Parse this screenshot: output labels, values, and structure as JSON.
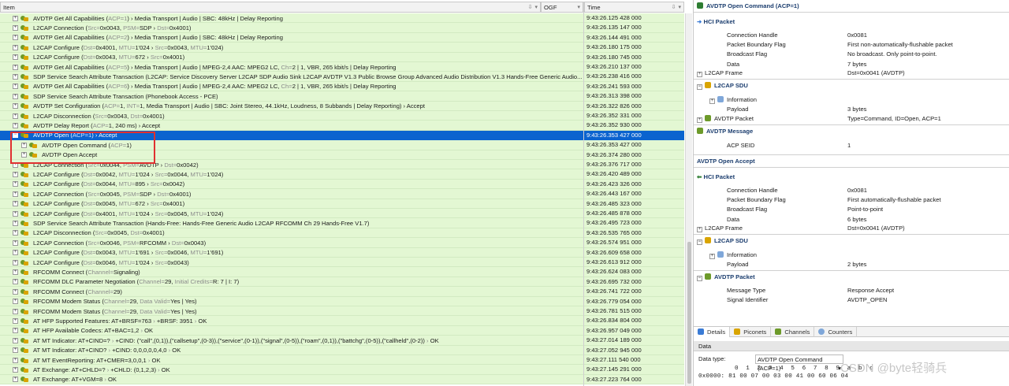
{
  "list": {
    "col_item": "Item",
    "col_ogf": "OGF",
    "col_time": "Time",
    "rows": [
      {
        "t": "+",
        "ind": 0,
        "s": [
          [
            "AVDTP Get All Capabilities (",
            0
          ],
          [
            "ACP=1",
            1
          ],
          [
            ") › Media Transport | Audio | SBC: 48kHz | Delay Reporting",
            0
          ]
        ],
        "time": "9:43:26.125 428 000"
      },
      {
        "t": "+",
        "ind": 0,
        "s": [
          [
            "L2CAP Connection (",
            0
          ],
          [
            "Src=",
            1
          ],
          [
            "0x0043, ",
            0
          ],
          [
            "PSM=",
            1
          ],
          [
            "SDP › ",
            0
          ],
          [
            "Dst=",
            1
          ],
          [
            "0x4001)",
            0
          ]
        ],
        "time": "9:43:26.135 147 000"
      },
      {
        "t": "+",
        "ind": 0,
        "s": [
          [
            "AVDTP Get All Capabilities (",
            0
          ],
          [
            "ACP=2",
            1
          ],
          [
            ") › Media Transport | Audio | SBC: 48kHz | Delay Reporting",
            0
          ]
        ],
        "time": "9:43:26.144 491 000"
      },
      {
        "t": "+",
        "ind": 0,
        "s": [
          [
            "L2CAP Configure (",
            0
          ],
          [
            "Dst=",
            1
          ],
          [
            "0x4001, ",
            0
          ],
          [
            "MTU=",
            1
          ],
          [
            "1'024 › ",
            0
          ],
          [
            "Src=",
            1
          ],
          [
            "0x0043, ",
            0
          ],
          [
            "MTU=",
            1
          ],
          [
            "1'024)",
            0
          ]
        ],
        "time": "9:43:26.180 175 000"
      },
      {
        "t": "+",
        "ind": 0,
        "s": [
          [
            "L2CAP Configure (",
            0
          ],
          [
            "Dst=",
            1
          ],
          [
            "0x0043, ",
            0
          ],
          [
            "MTU=",
            1
          ],
          [
            "672 › ",
            0
          ],
          [
            "Src=",
            1
          ],
          [
            "0x4001)",
            0
          ]
        ],
        "time": "9:43:26.180 745 000"
      },
      {
        "t": "+",
        "ind": 0,
        "s": [
          [
            "AVDTP Get All Capabilities (",
            0
          ],
          [
            "ACP=5",
            1
          ],
          [
            ") › Media Transport | Audio | MPEG-2,4 AAC: MPEG2 LC, ",
            0
          ],
          [
            "Ch=",
            1
          ],
          [
            "2 | 1, VBR, 265 kbit/s | Delay Reporting",
            0
          ]
        ],
        "time": "9:43:26.210 137 000"
      },
      {
        "t": "+",
        "ind": 0,
        "s": [
          [
            "SDP Service Search Attribute Transaction (L2CAP: Service Discovery Server L2CAP SDP Audio Sink L2CAP AVDTP V1.3 Public Browse Group Advanced Audio Distribution V1.3 Hands-Free Generic Audio...",
            0
          ]
        ],
        "time": "9:43:26.238 416 000"
      },
      {
        "t": "+",
        "ind": 0,
        "s": [
          [
            "AVDTP Get All Capabilities (",
            0
          ],
          [
            "ACP=6",
            1
          ],
          [
            ") › Media Transport | Audio | MPEG-2,4 AAC: MPEG2 LC, ",
            0
          ],
          [
            "Ch=",
            1
          ],
          [
            "2 | 1, VBR, 265 kbit/s | Delay Reporting",
            0
          ]
        ],
        "time": "9:43:26.241 593 000"
      },
      {
        "t": "+",
        "ind": 0,
        "s": [
          [
            "SDP Service Search Attribute Transaction (Phonebook Access - PCE)",
            0
          ]
        ],
        "time": "9:43:26.313 398 000"
      },
      {
        "t": "+",
        "ind": 0,
        "s": [
          [
            "AVDTP Set Configuration (",
            0
          ],
          [
            "ACP=",
            1
          ],
          [
            "1, ",
            0
          ],
          [
            "INT=",
            1
          ],
          [
            "1, Media Transport | Audio | SBC: Joint Stereo, 44.1kHz, Loudness, 8 Subbands | Delay Reporting) › Accept",
            0
          ]
        ],
        "time": "9:43:26.322 826 000"
      },
      {
        "t": "+",
        "ind": 0,
        "s": [
          [
            "L2CAP Disconnection (",
            0
          ],
          [
            "Src=",
            1
          ],
          [
            "0x0043, ",
            0
          ],
          [
            "Dst=",
            1
          ],
          [
            "0x4001)",
            0
          ]
        ],
        "time": "9:43:26.352 331 000"
      },
      {
        "t": "+",
        "ind": 0,
        "s": [
          [
            "AVDTP Delay Report (",
            0
          ],
          [
            "ACP=",
            1
          ],
          [
            "1, 240 ms) › Accept",
            0
          ]
        ],
        "time": "9:43:26.352 930 000"
      },
      {
        "t": "−",
        "ind": 0,
        "sel": true,
        "s": [
          [
            "AVDTP Open (",
            0
          ],
          [
            "ACP=1",
            1
          ],
          [
            ") › Accept",
            0
          ]
        ],
        "time": "9:43:26.353 427 000"
      },
      {
        "t": "+",
        "ind": 1,
        "s": [
          [
            "AVDTP Open Command (",
            0
          ],
          [
            "ACP=",
            1
          ],
          [
            "1)",
            0
          ]
        ],
        "time": "9:43:26.353 427 000"
      },
      {
        "t": "+",
        "ind": 1,
        "s": [
          [
            "AVDTP Open Accept",
            0
          ]
        ],
        "time": "9:43:26.374 280 000"
      },
      {
        "t": "+",
        "ind": 0,
        "s": [
          [
            "L2CAP Connection (",
            0
          ],
          [
            "Src=",
            1
          ],
          [
            "0x0044, ",
            0
          ],
          [
            "PSM=",
            1
          ],
          [
            "AVDTP › ",
            0
          ],
          [
            "Dst=",
            1
          ],
          [
            "0x0042)",
            0
          ]
        ],
        "time": "9:43:26.376 717 000"
      },
      {
        "t": "+",
        "ind": 0,
        "s": [
          [
            "L2CAP Configure (",
            0
          ],
          [
            "Dst=",
            1
          ],
          [
            "0x0042, ",
            0
          ],
          [
            "MTU=",
            1
          ],
          [
            "1'024 › ",
            0
          ],
          [
            "Src=",
            1
          ],
          [
            "0x0044, ",
            0
          ],
          [
            "MTU=",
            1
          ],
          [
            "1'024)",
            0
          ]
        ],
        "time": "9:43:26.420 489 000"
      },
      {
        "t": "+",
        "ind": 0,
        "s": [
          [
            "L2CAP Configure (",
            0
          ],
          [
            "Dst=",
            1
          ],
          [
            "0x0044, ",
            0
          ],
          [
            "MTU=",
            1
          ],
          [
            "895 › ",
            0
          ],
          [
            "Src=",
            1
          ],
          [
            "0x0042)",
            0
          ]
        ],
        "time": "9:43:26.423 326 000"
      },
      {
        "t": "+",
        "ind": 0,
        "s": [
          [
            "L2CAP Connection (",
            0
          ],
          [
            "Src=",
            1
          ],
          [
            "0x0045, ",
            0
          ],
          [
            "PSM=",
            1
          ],
          [
            "SDP › ",
            0
          ],
          [
            "Dst=",
            1
          ],
          [
            "0x4001)",
            0
          ]
        ],
        "time": "9:43:26.443 167 000"
      },
      {
        "t": "+",
        "ind": 0,
        "s": [
          [
            "L2CAP Configure (",
            0
          ],
          [
            "Dst=",
            1
          ],
          [
            "0x0045, ",
            0
          ],
          [
            "MTU=",
            1
          ],
          [
            "672 › ",
            0
          ],
          [
            "Src=",
            1
          ],
          [
            "0x4001)",
            0
          ]
        ],
        "time": "9:43:26.485 323 000"
      },
      {
        "t": "+",
        "ind": 0,
        "s": [
          [
            "L2CAP Configure (",
            0
          ],
          [
            "Dst=",
            1
          ],
          [
            "0x4001, ",
            0
          ],
          [
            "MTU=",
            1
          ],
          [
            "1'024 › ",
            0
          ],
          [
            "Src=",
            1
          ],
          [
            "0x0045, ",
            0
          ],
          [
            "MTU=",
            1
          ],
          [
            "1'024)",
            0
          ]
        ],
        "time": "9:43:26.485 878 000"
      },
      {
        "t": "+",
        "ind": 0,
        "s": [
          [
            "SDP Service Search Attribute Transaction (Hands-Free: Hands-Free Generic Audio L2CAP RFCOMM Ch 29 Hands-Free V1.7)",
            0
          ]
        ],
        "time": "9:43:26.495 723 000"
      },
      {
        "t": "+",
        "ind": 0,
        "s": [
          [
            "L2CAP Disconnection (",
            0
          ],
          [
            "Src=",
            1
          ],
          [
            "0x0045, ",
            0
          ],
          [
            "Dst=",
            1
          ],
          [
            "0x4001)",
            0
          ]
        ],
        "time": "9:43:26.535 765 000"
      },
      {
        "t": "+",
        "ind": 0,
        "s": [
          [
            "L2CAP Connection (",
            0
          ],
          [
            "Src=",
            1
          ],
          [
            "0x0046, ",
            0
          ],
          [
            "PSM=",
            1
          ],
          [
            "RFCOMM › ",
            0
          ],
          [
            "Dst=",
            1
          ],
          [
            "0x0043)",
            0
          ]
        ],
        "time": "9:43:26.574 951 000"
      },
      {
        "t": "+",
        "ind": 0,
        "s": [
          [
            "L2CAP Configure (",
            0
          ],
          [
            "Dst=",
            1
          ],
          [
            "0x0043, ",
            0
          ],
          [
            "MTU=",
            1
          ],
          [
            "1'691 › ",
            0
          ],
          [
            "Src=",
            1
          ],
          [
            "0x0046, ",
            0
          ],
          [
            "MTU=",
            1
          ],
          [
            "1'691)",
            0
          ]
        ],
        "time": "9:43:26.609 658 000"
      },
      {
        "t": "+",
        "ind": 0,
        "s": [
          [
            "L2CAP Configure (",
            0
          ],
          [
            "Dst=",
            1
          ],
          [
            "0x0046, ",
            0
          ],
          [
            "MTU=",
            1
          ],
          [
            "1'024 › ",
            0
          ],
          [
            "Src=",
            1
          ],
          [
            "0x0043)",
            0
          ]
        ],
        "time": "9:43:26.613 912 000"
      },
      {
        "t": "+",
        "ind": 0,
        "s": [
          [
            "RFCOMM Connect (",
            0
          ],
          [
            "Channel=",
            1
          ],
          [
            "Signaling)",
            0
          ]
        ],
        "time": "9:43:26.624 083 000"
      },
      {
        "t": "+",
        "ind": 0,
        "s": [
          [
            "RFCOMM DLC Parameter Negotiation (",
            0
          ],
          [
            "Channel=",
            1
          ],
          [
            "29, ",
            0
          ],
          [
            "Initial Credits=",
            1
          ],
          [
            "R: 7 | I: 7)",
            0
          ]
        ],
        "time": "9:43:26.695 732 000"
      },
      {
        "t": "+",
        "ind": 0,
        "s": [
          [
            "RFCOMM Connect (",
            0
          ],
          [
            "Channel=",
            1
          ],
          [
            "29)",
            0
          ]
        ],
        "time": "9:43:26.741 722 000"
      },
      {
        "t": "+",
        "ind": 0,
        "s": [
          [
            "RFCOMM Modem Status (",
            0
          ],
          [
            "Channel=",
            1
          ],
          [
            "29, ",
            0
          ],
          [
            "Data Valid=",
            1
          ],
          [
            "Yes | Yes)",
            0
          ]
        ],
        "time": "9:43:26.779 054 000"
      },
      {
        "t": "+",
        "ind": 0,
        "s": [
          [
            "RFCOMM Modem Status (",
            0
          ],
          [
            "Channel=",
            1
          ],
          [
            "29, ",
            0
          ],
          [
            "Data Valid=",
            1
          ],
          [
            "Yes | Yes)",
            0
          ]
        ],
        "time": "9:43:26.781 515 000"
      },
      {
        "t": "+",
        "ind": 0,
        "s": [
          [
            "AT HFP Supported Features: AT+BRSF=763 ",
            0
          ],
          [
            "› ",
            1
          ],
          [
            "+BRSF: 3951 ",
            0
          ],
          [
            "› ",
            1
          ],
          [
            "OK",
            0
          ]
        ],
        "time": "9:43:26.834 804 000"
      },
      {
        "t": "+",
        "ind": 0,
        "s": [
          [
            "AT HFP Available Codecs: AT+BAC=1,2 ",
            0
          ],
          [
            "› ",
            1
          ],
          [
            "OK",
            0
          ]
        ],
        "time": "9:43:26.957 049 000"
      },
      {
        "t": "+",
        "ind": 0,
        "s": [
          [
            "AT MT Indicator: AT+CIND=? ",
            0
          ],
          [
            "› ",
            1
          ],
          [
            "+CIND: (\"call\",(0,1)),(\"callsetup\",(0-3)),(\"service\",(0-1)),(\"signal\",(0-5)),(\"roam\",(0,1)),(\"battchg\",(0-5)),(\"callheld\",(0-2)) ",
            0
          ],
          [
            "› ",
            1
          ],
          [
            "OK",
            0
          ]
        ],
        "time": "9:43:27.014 189 000"
      },
      {
        "t": "+",
        "ind": 0,
        "s": [
          [
            "AT MT Indicator: AT+CIND? ",
            0
          ],
          [
            "› ",
            1
          ],
          [
            "+CIND: 0,0,0,0,0,4,0 ",
            0
          ],
          [
            "› ",
            1
          ],
          [
            "OK",
            0
          ]
        ],
        "time": "9:43:27.052 945 000"
      },
      {
        "t": "+",
        "ind": 0,
        "s": [
          [
            "AT MT EventReporting: AT+CMER=3,0,0,1 ",
            0
          ],
          [
            "› ",
            1
          ],
          [
            "OK",
            0
          ]
        ],
        "time": "9:43:27.111 540 000"
      },
      {
        "t": "+",
        "ind": 0,
        "s": [
          [
            "AT Exchange: AT+CHLD=? ",
            0
          ],
          [
            "› ",
            1
          ],
          [
            "+CHLD: (0,1,2,3) ",
            0
          ],
          [
            "› ",
            1
          ],
          [
            "OK",
            0
          ]
        ],
        "time": "9:43:27.145 291 000"
      },
      {
        "t": "+",
        "ind": 0,
        "s": [
          [
            "AT Exchange: AT+VGM=8 ",
            0
          ],
          [
            "› ",
            1
          ],
          [
            "OK",
            0
          ]
        ],
        "time": "9:43:27.223 764 000"
      }
    ]
  },
  "details": {
    "cmd_title": "AVDTP Open Command (ACP=1)",
    "cmd_hci_title": "HCI Packet",
    "cmd_hci": [
      {
        "label": "Connection Handle",
        "value": "0x0081"
      },
      {
        "label": "Packet Boundary Flag",
        "value": "First non-automatically-flushable packet"
      },
      {
        "label": "Broadcast Flag",
        "value": "No broadcast. Only point-to-point."
      },
      {
        "label": "Data",
        "value": "7 bytes"
      }
    ],
    "cmd_l2cap_frame": {
      "label": "L2CAP Frame",
      "value": "Dst=0x0041 (AVDTP)"
    },
    "cmd_sdu_title": "L2CAP SDU",
    "cmd_sdu_info": "Information",
    "cmd_sdu_payload": {
      "label": "Payload",
      "value": "3 bytes"
    },
    "cmd_avdtp_packet": {
      "label": "AVDTP Packet",
      "value": "Type=Command, ID=Open, ACP=1"
    },
    "cmd_msg_title": "AVDTP Message",
    "cmd_msg": {
      "label": "ACP SEID",
      "value": "1"
    },
    "acc_title": "AVDTP Open Accept",
    "acc_hci_title": "HCI Packet",
    "acc_hci": [
      {
        "label": "Connection Handle",
        "value": "0x0081"
      },
      {
        "label": "Packet Boundary Flag",
        "value": "First automatically-flushable packet"
      },
      {
        "label": "Broadcast Flag",
        "value": "Point-to-point"
      },
      {
        "label": "Data",
        "value": "6 bytes"
      }
    ],
    "acc_l2cap_frame": {
      "label": "L2CAP Frame",
      "value": "Dst=0x0041 (AVDTP)"
    },
    "acc_sdu_title": "L2CAP SDU",
    "acc_sdu_info": "Information",
    "acc_sdu_payload": {
      "label": "Payload",
      "value": "2 bytes"
    },
    "acc_pkt_title": "AVDTP Packet",
    "acc_pkt": [
      {
        "label": "Message Type",
        "value": "Response Accept"
      },
      {
        "label": "Signal Identifier",
        "value": "AVDTP_OPEN"
      }
    ]
  },
  "tabs": [
    "Details",
    "Piconets",
    "Channels",
    "Counters"
  ],
  "data_pane": {
    "title": "Data",
    "type_label": "Data type:",
    "type_value": "AVDTP Open Command (ACP=1)",
    "hex_header": "0  1  2  3  4  5  6  7  8  9  a  b  c",
    "hex_offset": "0x0000:",
    "hex_bytes": "81 00 07 00 03 00 41 00 60 06 04"
  },
  "watermark": "CSDN @byte轻骑兵",
  "colors": {
    "row_green": "#e3f7d3",
    "selected": "#0b63cf",
    "highlight_box": "#e03030"
  }
}
